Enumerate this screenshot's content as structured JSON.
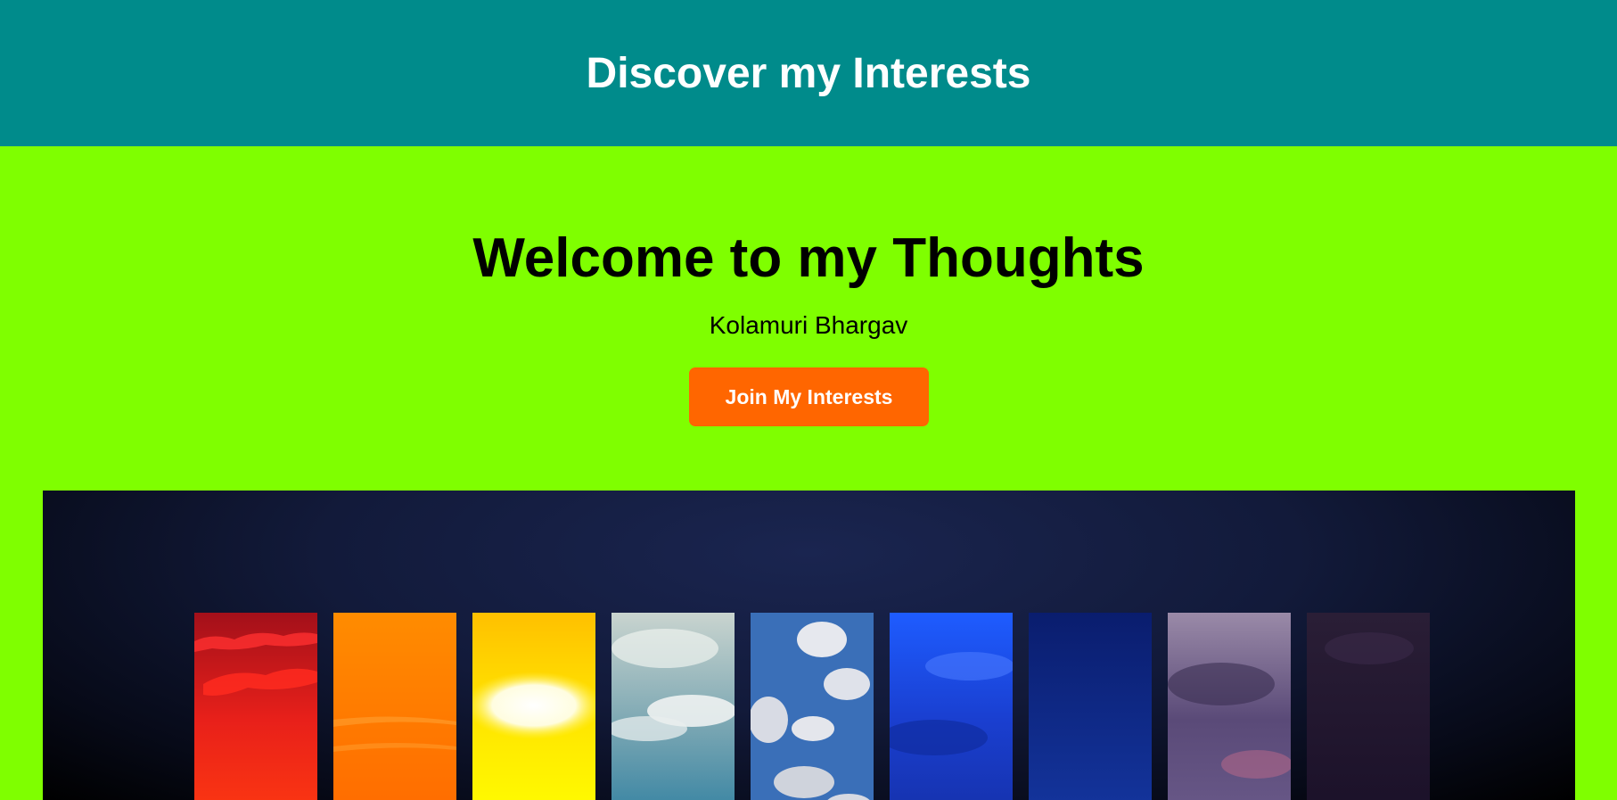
{
  "header": {
    "title": "Discover my Interests"
  },
  "hero": {
    "title": "Welcome to my Thoughts",
    "subtitle": "Kolamuri Bhargav",
    "cta_label": "Join My Interests"
  },
  "colors": {
    "header_bg": "#008b8b",
    "hero_bg": "#7fff00",
    "button_bg": "#ff6600"
  }
}
